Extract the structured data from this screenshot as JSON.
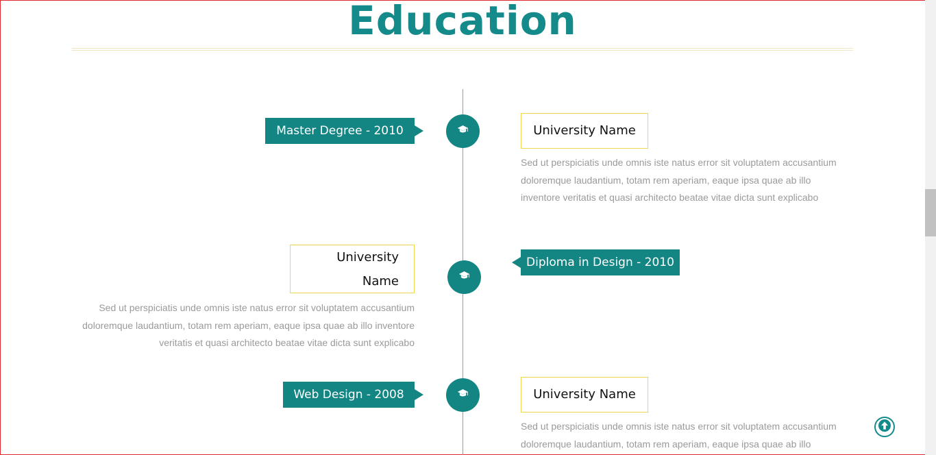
{
  "section": {
    "title": "Education"
  },
  "entries": [
    {
      "tag": "Master Degree - 2010",
      "university": "University Name",
      "description": "Sed ut perspiciatis unde omnis iste natus error sit voluptatem accusantium doloremque laudantium, totam rem aperiam, eaque ipsa quae ab illo inventore veritatis et quasi architecto beatae vitae dicta sunt explicabo"
    },
    {
      "tag": "Diploma in Design - 2010",
      "university": "University Name",
      "description": "Sed ut perspiciatis unde omnis iste natus error sit voluptatem accusantium doloremque laudantium, totam rem aperiam, eaque ipsa quae ab illo inventore veritatis et quasi architecto beatae vitae dicta sunt explicabo"
    },
    {
      "tag": "Web Design - 2008",
      "university": "University Name",
      "description": "Sed ut perspiciatis unde omnis iste natus error sit voluptatem accusantium doloremque laudantium, totam rem aperiam, eaque ipsa quae ab illo inventore veritatis et quasi architecto beatae vitae dicta sunt explicabo"
    }
  ],
  "icons": {
    "node": "graduation-cap-icon",
    "back_to_top": "arrow-up-circle-icon"
  },
  "colors": {
    "accent": "#138583",
    "title": "#148a8a",
    "card_border": "#f1d64c",
    "text_muted": "#9a9a9a"
  }
}
